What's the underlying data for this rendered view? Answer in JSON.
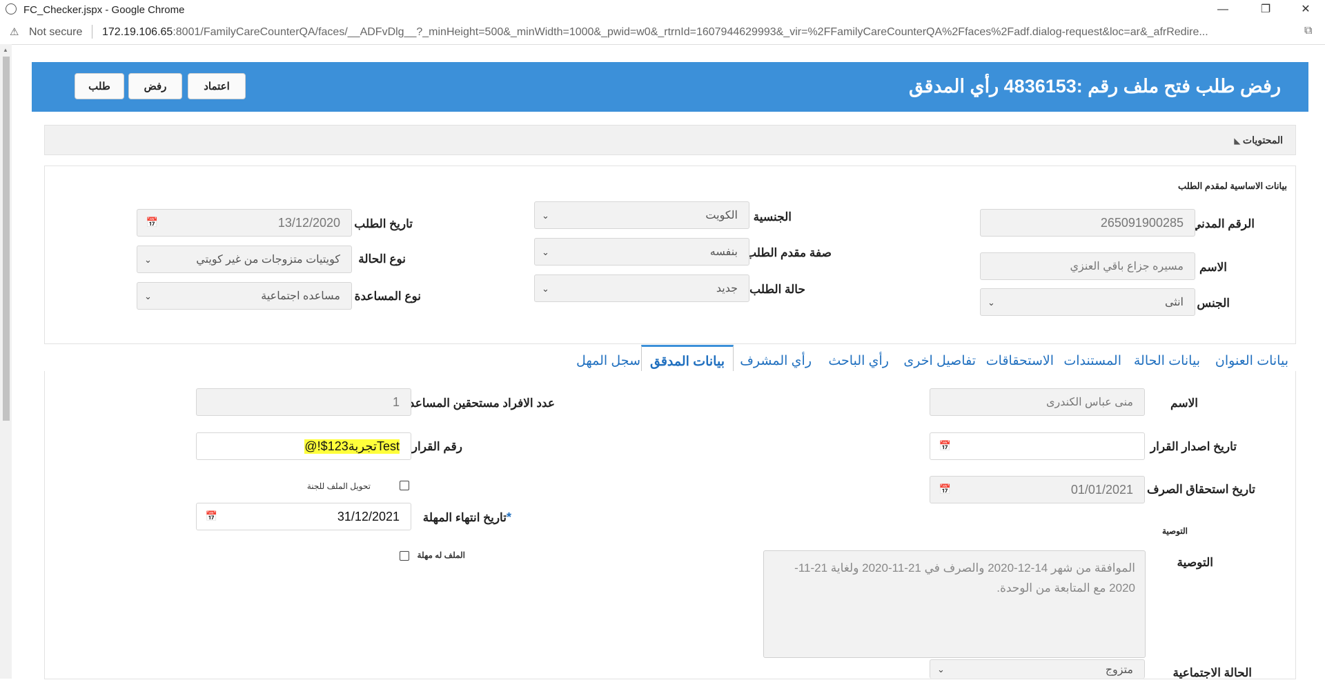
{
  "browser": {
    "window_title": "FC_Checker.jspx - Google Chrome",
    "security_label": "Not secure",
    "url_host": "172.19.106.65",
    "url_rest": ":8001/FamilyCareCounterQA/faces/__ADFvDlg__?_minHeight=500&_minWidth=1000&_pwid=w0&_rtrnId=1607944629993&_vir=%2FFamilyCareCounterQA%2Ffaces%2Fadf.dialog-request&loc=ar&_afrRedire..."
  },
  "header": {
    "title": "رفض طلب فتح ملف رقم :4836153 رأي المدقق",
    "buttons": {
      "approve": "اعتماد",
      "reject": "رفض",
      "request": "طلب"
    }
  },
  "contents_label": "المحتويات",
  "applicant": {
    "section_title": "بيانات الاساسية لمقدم الطلب",
    "civil_id_label": "الرقم المدني",
    "civil_id": "265091900285",
    "name_label": "الاسم",
    "name": "مسيره جزاع باقي العنزي",
    "gender_label": "الجنس",
    "gender": "انثى",
    "nationality_label": "الجنسية",
    "nationality": "الكويت",
    "applicant_capacity_label": "صفة مقدم الطلب",
    "applicant_capacity": "بنفسه",
    "request_status_label": "حالة الطلب",
    "request_status": "جديد",
    "request_date_label": "تاريخ الطلب",
    "request_date": "13/12/2020",
    "case_type_label": "نوع الحالة",
    "case_type": "كويتيات متزوجات من غير كويتي",
    "aid_type_label": "نوع المساعدة",
    "aid_type": "مساعده اجتماعية"
  },
  "tabs": [
    "بيانات العنوان",
    "بيانات الحالة",
    "المستندات",
    "الاستحقاقات",
    "تفاصيل اخرى",
    "رأي الباحث",
    "رأي المشرف",
    "بيانات المدقق",
    "سجل المهل"
  ],
  "auditor": {
    "name_label": "الاسم",
    "name": "منى عباس الكندرى",
    "decision_date_label": "تاريخ اصدار القرار",
    "decision_date": "",
    "disbursement_date_label": "تاريخ استحقاق الصرف",
    "disbursement_date": "01/01/2021",
    "recommendation_section": "التوصية",
    "recommendation_label": "التوصية",
    "recommendation": "الموافقة من شهر 14-12-2020 والصرف في 21-11-2020 ولغاية 21-11-2020 مع المتابعة من الوحدة.",
    "marital_status_label": "الحالة الاجتماعية",
    "marital_status": "متزوج",
    "members_label": "عدد الافراد مستحقين المساعدة",
    "members": "1",
    "decision_no_label": "رقم القرار",
    "decision_no": "Testتجربة123$!@",
    "transfer_label": "تحويل الملف للجنة",
    "deadline_label": "تاريخ انتهاء المهلة",
    "deadline_required": "*",
    "deadline": "31/12/2021",
    "has_deadline_label": "الملف له مهلة"
  },
  "colors": {
    "header_blue": "#3c90d9",
    "tab_link": "#1f6fbf",
    "highlight": "#ffff3b"
  }
}
